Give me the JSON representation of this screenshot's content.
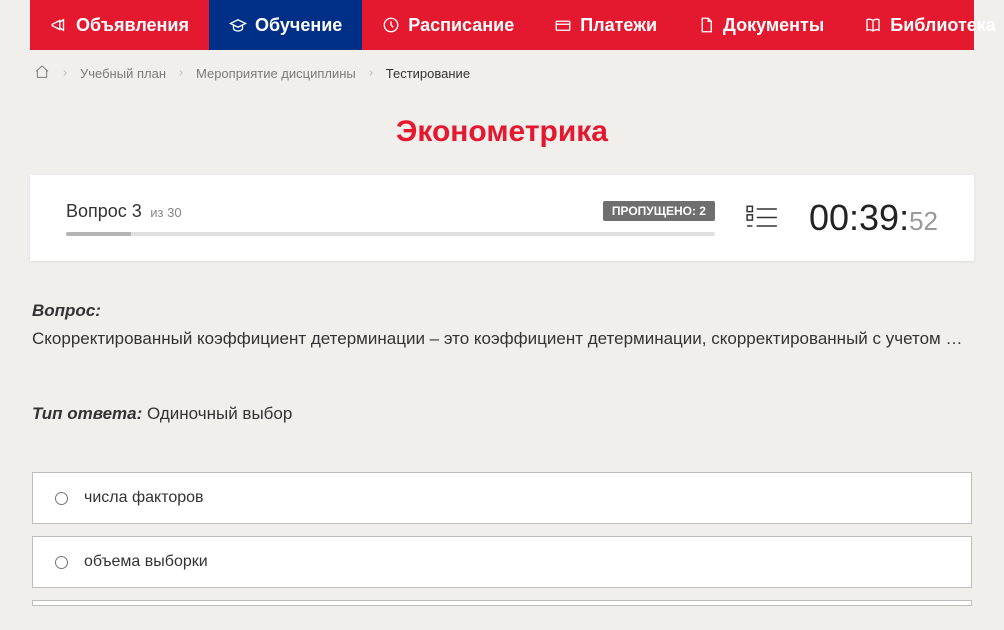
{
  "nav": {
    "items": [
      {
        "label": "Объявления"
      },
      {
        "label": "Обучение"
      },
      {
        "label": "Расписание"
      },
      {
        "label": "Платежи"
      },
      {
        "label": "Документы"
      },
      {
        "label": "Библиотека"
      }
    ]
  },
  "breadcrumb": {
    "items": [
      {
        "label": "Учебный план"
      },
      {
        "label": "Мероприятие дисциплины"
      },
      {
        "label": "Тестирование"
      }
    ]
  },
  "page_title": "Эконометрика",
  "progress": {
    "question_label": "Вопрос 3",
    "total_label": "из 30",
    "skipped_label": "ПРОПУЩЕНО: 2"
  },
  "timer": {
    "main": "00:39:",
    "ms": "52"
  },
  "question": {
    "label": "Вопрос:",
    "text": "Скорректированный коэффициент детерминации – это коэффициент детерминации, скорректированный с учетом …"
  },
  "answer_type": {
    "label": "Тип ответа:",
    "value": "Одиночный выбор"
  },
  "options": [
    {
      "label": "числа факторов"
    },
    {
      "label": "объема выборки"
    }
  ]
}
